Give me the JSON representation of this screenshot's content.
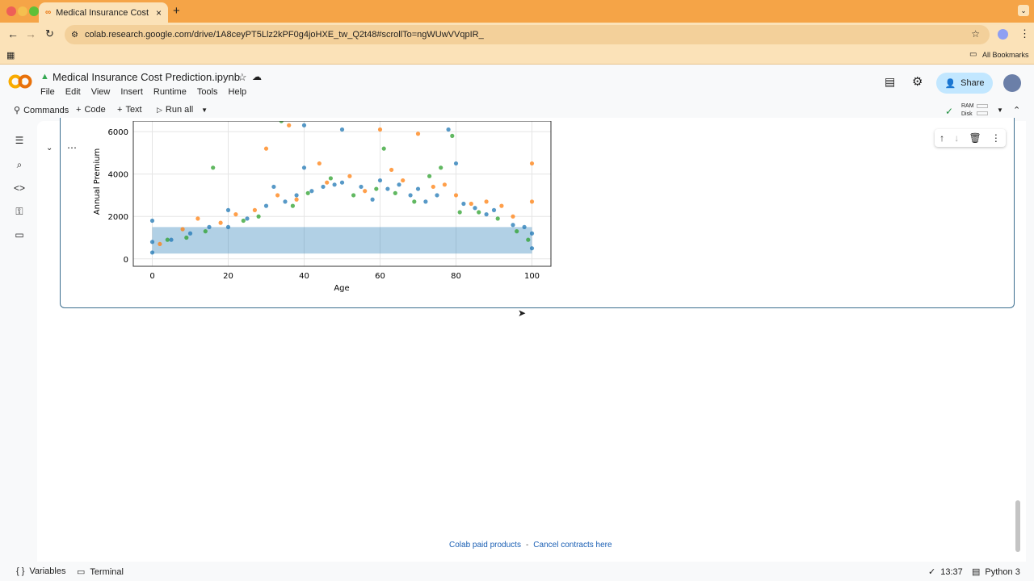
{
  "browser": {
    "tab_title": "Medical Insurance Cost Predi",
    "url": "colab.research.google.com/drive/1A8ceyPT5Llz2kPF0g4joHXE_tw_Q2t48#scrollTo=ngWUwVVqpIR_",
    "bookmarks_label": "All Bookmarks"
  },
  "colab": {
    "notebook_title": "Medical Insurance Cost Prediction.ipynb",
    "menu": [
      "File",
      "Edit",
      "View",
      "Insert",
      "Runtime",
      "Tools",
      "Help"
    ],
    "toolbar": {
      "commands": "Commands",
      "code": "Code",
      "text": "Text",
      "run_all": "Run all"
    },
    "share_label": "Share",
    "ram_label": "RAM",
    "disk_label": "Disk"
  },
  "chart_data": {
    "type": "scatter",
    "xlabel": "Age",
    "ylabel": "Annual Premium",
    "x_ticks": [
      "0",
      "20",
      "40",
      "60",
      "80",
      "100"
    ],
    "y_ticks": [
      "0",
      "2000",
      "4000",
      "6000"
    ],
    "xlim": [
      -5,
      105
    ],
    "ylim": [
      -350,
      6500
    ],
    "series_colors": [
      "#1f77b4",
      "#ff7f0e",
      "#2ca02c"
    ],
    "series": [
      {
        "points": [
          [
            0,
            300
          ],
          [
            0,
            800
          ],
          [
            0,
            1800
          ],
          [
            5,
            900
          ],
          [
            10,
            1200
          ],
          [
            15,
            1500
          ],
          [
            20,
            1500
          ],
          [
            20,
            2300
          ],
          [
            25,
            1900
          ],
          [
            30,
            2500
          ],
          [
            32,
            3400
          ],
          [
            35,
            2700
          ],
          [
            38,
            3000
          ],
          [
            40,
            4300
          ],
          [
            40,
            6300
          ],
          [
            42,
            3200
          ],
          [
            45,
            3400
          ],
          [
            48,
            3500
          ],
          [
            50,
            3600
          ],
          [
            50,
            6100
          ],
          [
            55,
            3400
          ],
          [
            58,
            2800
          ],
          [
            60,
            3700
          ],
          [
            62,
            3300
          ],
          [
            65,
            3500
          ],
          [
            68,
            3000
          ],
          [
            70,
            3300
          ],
          [
            72,
            2700
          ],
          [
            75,
            3000
          ],
          [
            78,
            6100
          ],
          [
            80,
            4500
          ],
          [
            82,
            2600
          ],
          [
            85,
            2400
          ],
          [
            88,
            2100
          ],
          [
            90,
            2300
          ],
          [
            95,
            1600
          ],
          [
            98,
            1500
          ],
          [
            100,
            1200
          ],
          [
            100,
            500
          ]
        ]
      },
      {
        "points": [
          [
            2,
            700
          ],
          [
            8,
            1400
          ],
          [
            12,
            1900
          ],
          [
            18,
            1700
          ],
          [
            22,
            2100
          ],
          [
            27,
            2300
          ],
          [
            30,
            5200
          ],
          [
            33,
            3000
          ],
          [
            36,
            6300
          ],
          [
            38,
            2800
          ],
          [
            44,
            4500
          ],
          [
            46,
            3600
          ],
          [
            52,
            3900
          ],
          [
            56,
            3200
          ],
          [
            60,
            6100
          ],
          [
            63,
            4200
          ],
          [
            66,
            3700
          ],
          [
            70,
            5900
          ],
          [
            74,
            3400
          ],
          [
            77,
            3500
          ],
          [
            80,
            3000
          ],
          [
            84,
            2600
          ],
          [
            88,
            2700
          ],
          [
            92,
            2500
          ],
          [
            95,
            2000
          ],
          [
            100,
            4500
          ],
          [
            100,
            2700
          ]
        ]
      },
      {
        "points": [
          [
            4,
            900
          ],
          [
            9,
            1000
          ],
          [
            14,
            1300
          ],
          [
            16,
            4300
          ],
          [
            24,
            1800
          ],
          [
            28,
            2000
          ],
          [
            34,
            6500
          ],
          [
            37,
            2500
          ],
          [
            41,
            3100
          ],
          [
            47,
            3800
          ],
          [
            53,
            3000
          ],
          [
            59,
            3300
          ],
          [
            61,
            5200
          ],
          [
            64,
            3100
          ],
          [
            69,
            2700
          ],
          [
            73,
            3900
          ],
          [
            76,
            4300
          ],
          [
            79,
            5800
          ],
          [
            81,
            2200
          ],
          [
            86,
            2200
          ],
          [
            91,
            1900
          ],
          [
            96,
            1300
          ],
          [
            99,
            900
          ]
        ]
      }
    ]
  },
  "footer": {
    "paid": "Colab paid products",
    "sep": "-",
    "cancel": "Cancel contracts here"
  },
  "status": {
    "variables": "Variables",
    "terminal": "Terminal",
    "time": "13:37",
    "kernel": "Python 3"
  }
}
